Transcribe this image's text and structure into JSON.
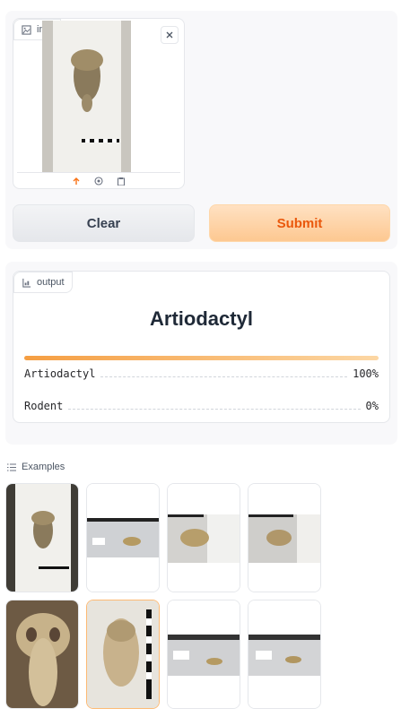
{
  "input": {
    "label": "img"
  },
  "buttons": {
    "clear": "Clear",
    "submit": "Submit"
  },
  "output": {
    "label": "output",
    "prediction": "Artiodactyl",
    "confidences": [
      {
        "label": "Artiodactyl",
        "value": "100%",
        "fraction": 1.0
      },
      {
        "label": "Rodent",
        "value": "0%",
        "fraction": 0.0
      }
    ]
  },
  "examples": {
    "label": "Examples",
    "thumbnails": [
      "skull-on-board-1",
      "rodent-skull-scale",
      "rodent-skull-side",
      "rodent-skull-top",
      "skull-closeup",
      "skull-with-scale",
      "rodent-skull-labels-1",
      "rodent-skull-labels-2"
    ]
  },
  "colors": {
    "accent": "#f97316",
    "submit_bg": "#fdc891"
  }
}
